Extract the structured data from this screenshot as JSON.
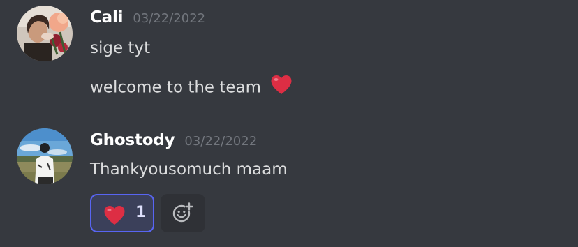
{
  "messages": [
    {
      "username": "Cali",
      "timestamp": "03/22/2022",
      "lines": [
        "sige tyt",
        "welcome to the team"
      ],
      "avatar_icon": "user-avatar-flowers"
    },
    {
      "username": "Ghostody",
      "timestamp": "03/22/2022",
      "lines": [
        "Thankyousomuch maam"
      ],
      "avatar_icon": "user-avatar-landscape",
      "reactions": [
        {
          "emoji": "red-heart",
          "count": "1",
          "reacted_by_me": true
        }
      ]
    }
  ],
  "colors": {
    "background": "#36393f",
    "username": "#ffffff",
    "message_text": "#dcddde",
    "timestamp": "#72767d",
    "reaction_border": "#5865f2",
    "reaction_bg": "#3b405a",
    "heart": "#dd2e44"
  },
  "icons": {
    "heart": "heart-emoji",
    "add_reaction": "add-reaction-icon"
  }
}
